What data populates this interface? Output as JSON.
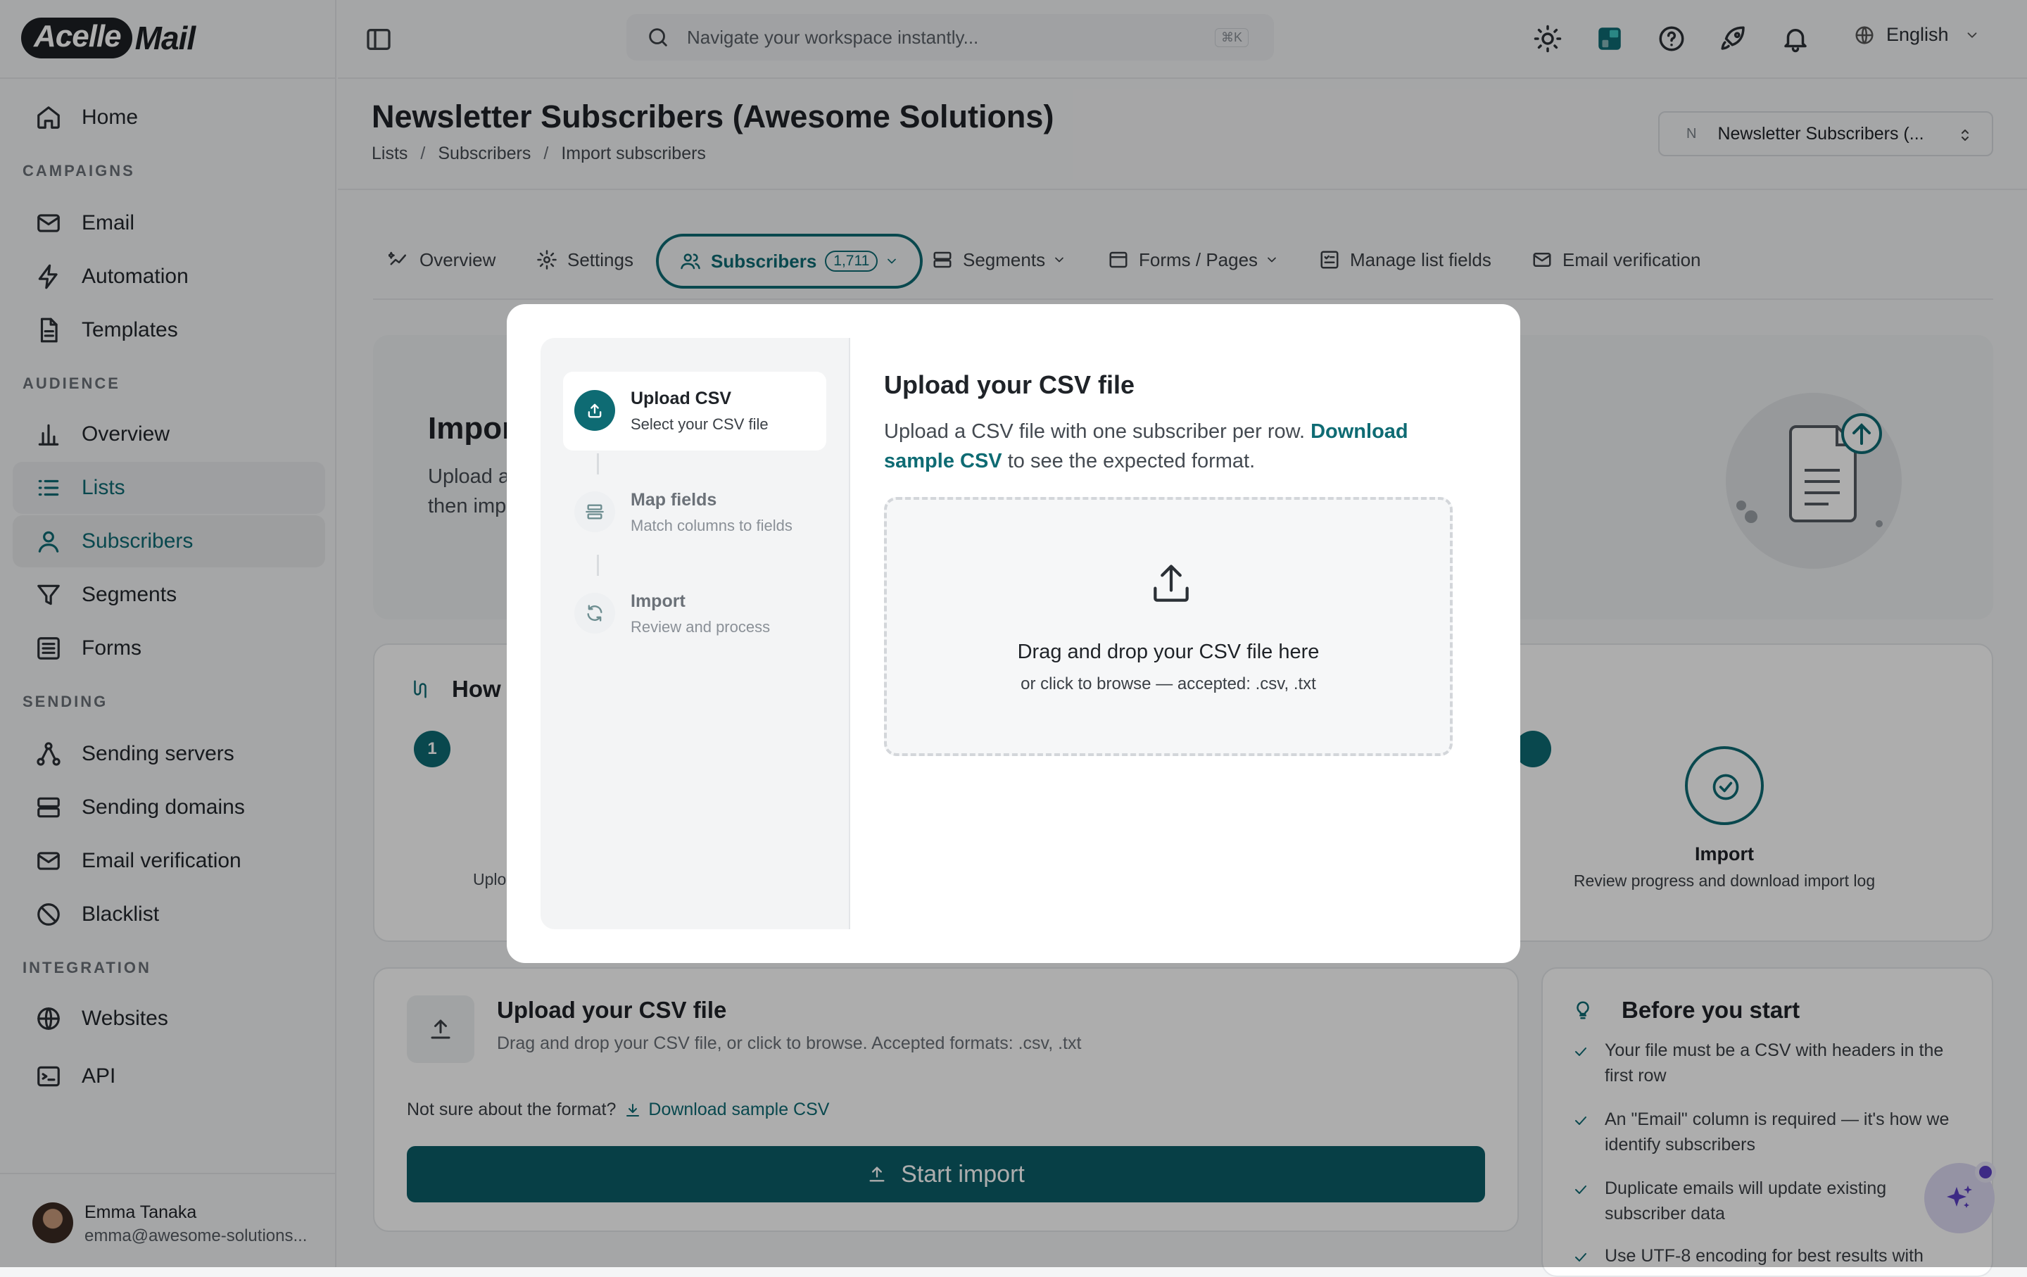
{
  "app": {
    "logo_pill": "Acelle",
    "logo_text": "Mail",
    "accent": "#0e6b73"
  },
  "sidebar": {
    "sections": {
      "campaigns": "CAMPAIGNS",
      "audience": "AUDIENCE",
      "sending": "SENDING",
      "integration": "INTEGRATION"
    },
    "items": [
      {
        "label": "Home",
        "icon": "home-icon"
      },
      {
        "label": "Email",
        "icon": "mail-icon"
      },
      {
        "label": "Automation",
        "icon": "bolt-icon"
      },
      {
        "label": "Templates",
        "icon": "document-icon"
      },
      {
        "label": "Overview",
        "icon": "bar-chart-icon"
      },
      {
        "label": "Lists",
        "icon": "list-icon"
      },
      {
        "label": "Subscribers",
        "icon": "user-icon"
      },
      {
        "label": "Segments",
        "icon": "filter-icon"
      },
      {
        "label": "Forms",
        "icon": "form-icon"
      },
      {
        "label": "Sending servers",
        "icon": "nodes-icon"
      },
      {
        "label": "Sending domains",
        "icon": "server-icon"
      },
      {
        "label": "Email verification",
        "icon": "mail-icon"
      },
      {
        "label": "Blacklist",
        "icon": "ban-icon"
      },
      {
        "label": "Websites",
        "icon": "globe-icon"
      },
      {
        "label": "API",
        "icon": "terminal-icon"
      }
    ],
    "user": {
      "name": "Emma Tanaka",
      "email": "emma@awesome-solutions..."
    }
  },
  "header": {
    "search_placeholder": "Navigate your workspace instantly...",
    "search_shortcut": "⌘K",
    "language": "English"
  },
  "page": {
    "title": "Newsletter Subscribers (Awesome Solutions)",
    "breadcrumb": [
      "Lists",
      "Subscribers",
      "Import subscribers"
    ],
    "list_switcher": {
      "badge": "N",
      "label": "Newsletter Subscribers (..."
    }
  },
  "tabs": [
    {
      "label": "Overview"
    },
    {
      "label": "Settings"
    },
    {
      "label": "Subscribers",
      "count": "1,711"
    },
    {
      "label": "Segments"
    },
    {
      "label": "Forms / Pages"
    },
    {
      "label": "Manage list fields"
    },
    {
      "label": "Email verification"
    }
  ],
  "background": {
    "hero_title": "Impor",
    "hero_text_1": "Upload a",
    "hero_text_2": "then imp",
    "how_title": "How",
    "how_step1_num": "1",
    "how_step_upload_partial": "Uplo",
    "how_step_import_title": "Import",
    "how_step_import_desc": "Review progress and download import log",
    "upload_card": {
      "title": "Upload your CSV file",
      "desc": "Drag and drop your CSV file, or click to browse. Accepted formats: .csv, .txt",
      "not_sure": "Not sure about the format?",
      "download_link": "Download sample CSV",
      "start_button": "Start import"
    },
    "before": {
      "title": "Before you start",
      "tips": [
        "Your file must be a CSV with headers in the first row",
        "An \"Email\" column is required — it's how we identify subscribers",
        "Duplicate emails will update existing subscriber data",
        "Use UTF-8 encoding for best results with"
      ]
    }
  },
  "modal": {
    "steps": [
      {
        "title": "Upload CSV",
        "desc": "Select your CSV file",
        "icon": "upload-icon"
      },
      {
        "title": "Map fields",
        "desc": "Match columns to fields",
        "icon": "map-fields-icon"
      },
      {
        "title": "Import",
        "desc": "Review and process",
        "icon": "refresh-icon"
      }
    ],
    "title": "Upload your CSV file",
    "desc_before": "Upload a CSV file with one subscriber per row. ",
    "desc_link": "Download sample CSV",
    "desc_after": " to see the expected format.",
    "dropzone_title": "Drag and drop your CSV file here",
    "dropzone_sub": "or click to browse — accepted: .csv, .txt"
  }
}
